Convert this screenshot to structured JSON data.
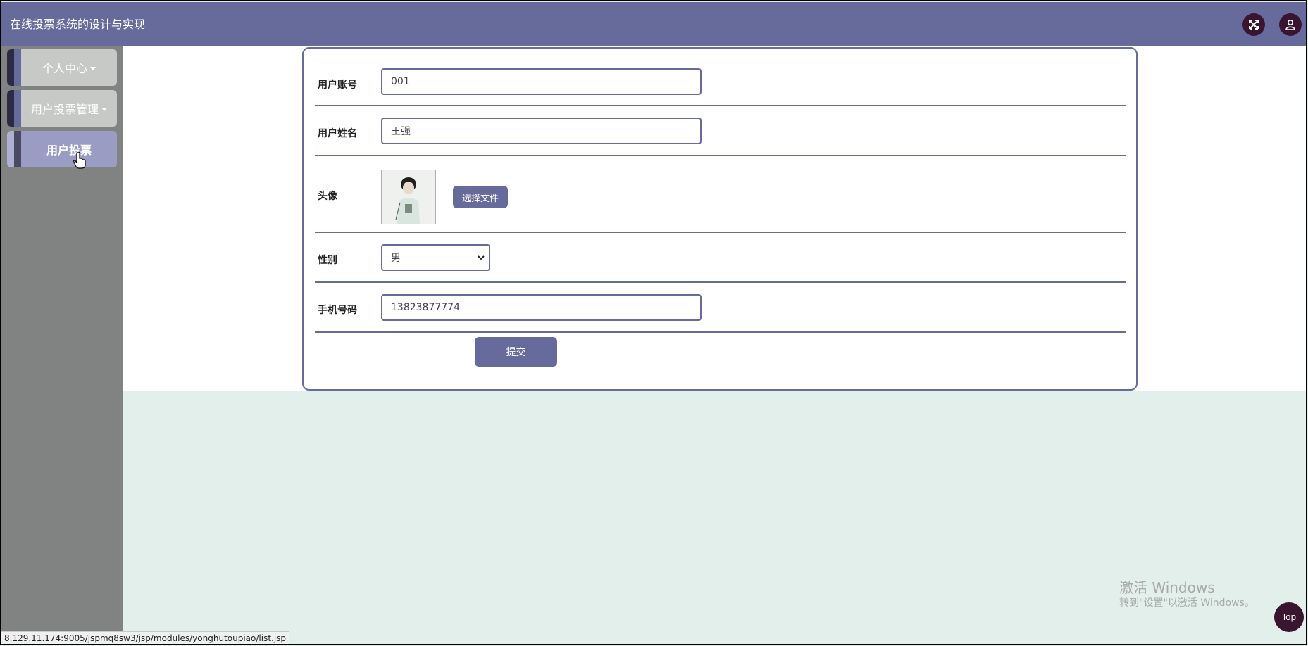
{
  "header": {
    "title": "在线投票系统的设计与实现",
    "icons": [
      "fullscreen-icon",
      "user-icon"
    ]
  },
  "sidebar": {
    "items": [
      {
        "label": "个人中心",
        "has_dropdown": true,
        "active": false
      },
      {
        "label": "用户投票管理",
        "has_dropdown": true,
        "active": false
      },
      {
        "label": "用户投票",
        "has_dropdown": false,
        "active": true
      }
    ]
  },
  "form": {
    "account": {
      "label": "用户账号",
      "value": "001"
    },
    "name": {
      "label": "用户姓名",
      "value": "王强"
    },
    "avatar": {
      "label": "头像",
      "button_label": "选择文件"
    },
    "gender": {
      "label": "性别",
      "selected": "男"
    },
    "phone": {
      "label": "手机号码",
      "value": "13823877774"
    },
    "submit_label": "提交"
  },
  "watermark": {
    "line1": "激活 Windows",
    "line2": "转到\"设置\"以激活 Windows。"
  },
  "top_button_label": "Top",
  "status_url": "8.129.11.174:9005/jspmq8sw3/jsp/modules/yonghutoupiao/list.jsp",
  "colors": {
    "primary": "#676b9b",
    "sidebar_bg": "#808381",
    "menu_bg": "#c7c9c7",
    "active_menu_bg": "#9a9cc4",
    "icon_circle": "#3a1530",
    "page_bg": "#e3efea"
  }
}
